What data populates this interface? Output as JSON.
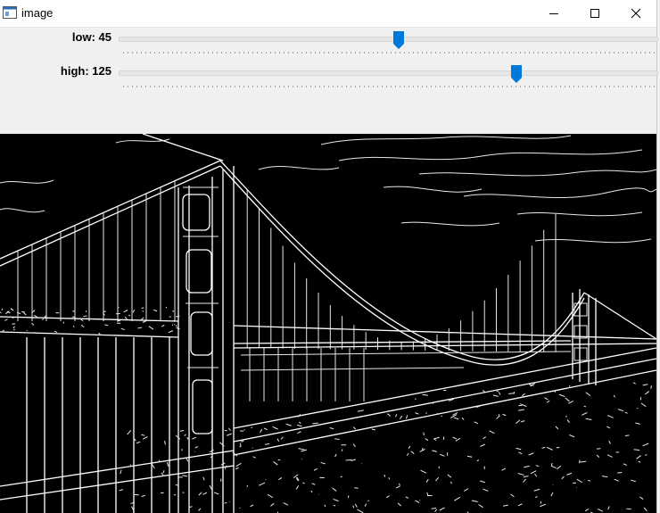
{
  "window": {
    "title": "image",
    "icon": "app-window-icon",
    "controls": {
      "minimize_icon": "minimize-icon",
      "maximize_icon": "maximize-icon",
      "close_icon": "close-icon"
    }
  },
  "trackbars": [
    {
      "label": "low: 45",
      "value": 45,
      "thumb_fraction": 0.52
    },
    {
      "label": "high: 125",
      "value": 125,
      "thumb_fraction": 0.74
    }
  ],
  "image": {
    "description_icon": "canny-edge-image",
    "background_color": "#000000",
    "edge_color": "#ffffff"
  },
  "colors": {
    "thumb": "#0078d7",
    "titlebar_bg": "#ffffff",
    "panel_bg": "#f0f0f0"
  }
}
